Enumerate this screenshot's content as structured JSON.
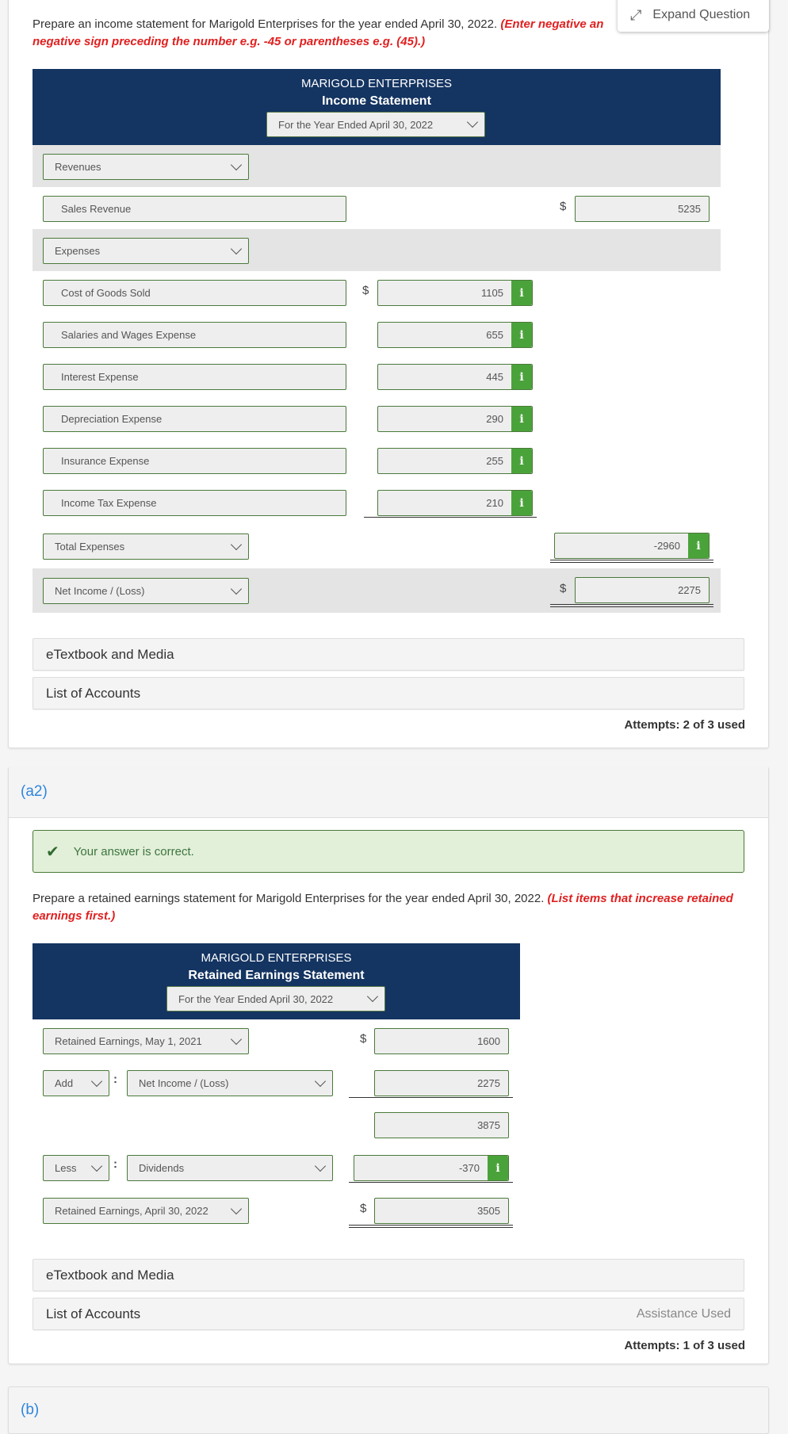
{
  "expand_button": {
    "icon": "expand-arrows-icon",
    "label": "Expand Question"
  },
  "part_a1": {
    "prompt": "Prepare an income statement for Marigold Enterprises for the year ended April 30, 2022.",
    "hint": "(Enter negative amounts using either a negative sign preceding the number e.g. -45 or parentheses e.g. (45).)",
    "hint_visible_line1": "(Enter negative an",
    "hint_visible_line2": "negative sign preceding the number e.g. -45 or parentheses e.g. (45).)",
    "statement": {
      "company": "MARIGOLD ENTERPRISES",
      "title": "Income Statement",
      "period": "For the Year Ended April 30, 2022"
    },
    "rows": {
      "revenues_heading": "Revenues",
      "sales_revenue": {
        "label": "Sales Revenue",
        "currency": "$",
        "value": "5235"
      },
      "expenses_heading": "Expenses",
      "expenses": [
        {
          "label": "Cost of Goods Sold",
          "currency": "$",
          "value": "1105"
        },
        {
          "label": "Salaries and Wages Expense",
          "value": "655"
        },
        {
          "label": "Interest Expense",
          "value": "445"
        },
        {
          "label": "Depreciation Expense",
          "value": "290"
        },
        {
          "label": "Insurance Expense",
          "value": "255"
        },
        {
          "label": "Income Tax Expense",
          "value": "210"
        }
      ],
      "total_expenses": {
        "label": "Total Expenses",
        "value": "-2960"
      },
      "net_income": {
        "label": "Net Income / (Loss)",
        "currency": "$",
        "value": "2275"
      }
    },
    "resources": {
      "etextbook": "eTextbook and Media",
      "accounts": "List of Accounts"
    },
    "attempts": "Attempts: 2 of 3 used"
  },
  "part_a2": {
    "label": "(a2)",
    "feedback": {
      "icon": "checkmark-icon",
      "text": "Your answer is correct."
    },
    "prompt": "Prepare a retained earnings statement for Marigold Enterprises for the year ended April 30, 2022.",
    "hint": "(List items that increase retained earnings first.)",
    "statement": {
      "company": "MARIGOLD ENTERPRISES",
      "title": "Retained Earnings Statement",
      "period": "For the Year Ended April 30, 2022"
    },
    "rows": {
      "beginning": {
        "label": "Retained Earnings, May 1, 2021",
        "currency": "$",
        "value": "1600"
      },
      "add": {
        "op": "Add",
        "label": "Net Income / (Loss)",
        "value": "2275"
      },
      "subtotal": {
        "value": "3875"
      },
      "less": {
        "op": "Less",
        "label": "Dividends",
        "value": "-370"
      },
      "ending": {
        "label": "Retained Earnings, April 30, 2022",
        "currency": "$",
        "value": "3505"
      }
    },
    "resources": {
      "etextbook": "eTextbook and Media",
      "accounts": "List of Accounts",
      "assistance": "Assistance Used"
    },
    "attempts": "Attempts: 1 of 3 used"
  },
  "part_b": {
    "label": "(b)"
  },
  "colors": {
    "navy_header": "#143461",
    "success_green": "#4aa33a",
    "hint_red": "#e02020",
    "link_blue": "#2e86de"
  }
}
